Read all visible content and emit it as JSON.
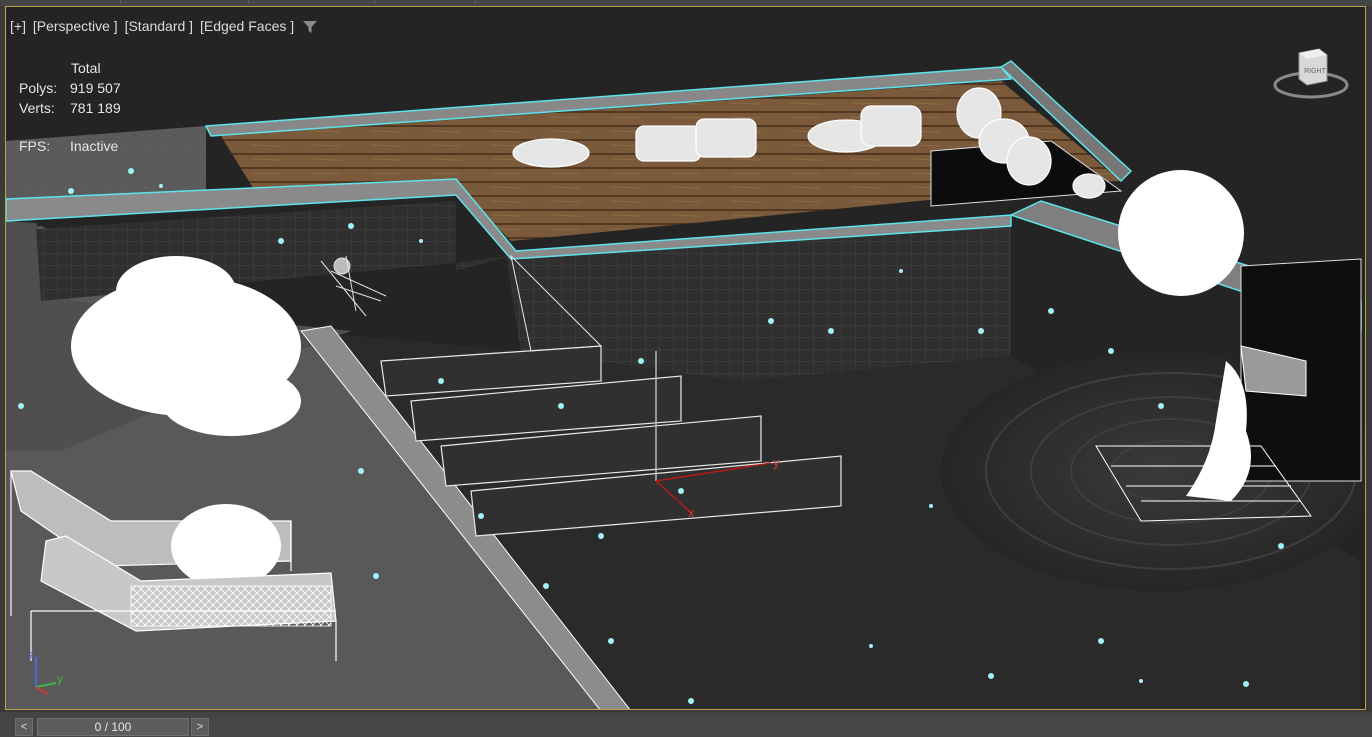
{
  "viewport": {
    "labels": [
      "[+]",
      "[Perspective ]",
      "[Standard ]",
      "[Edged Faces ]"
    ],
    "stats": {
      "header": "Total",
      "polys_label": "Polys:",
      "polys_value": "919 507",
      "verts_label": "Verts:",
      "verts_value": "781 189"
    },
    "fps": {
      "label": "FPS:",
      "value": "Inactive"
    },
    "viewcube_label": "RIGHT",
    "border_color": "#bfa248",
    "wire_color": "#5fe3ee"
  },
  "gizmo_axes": [
    "x",
    "y"
  ],
  "tripod_axes": [
    "y",
    "x",
    "z"
  ],
  "timeline": {
    "prev_label": "<",
    "frame_display": "0 / 100",
    "next_label": ">"
  },
  "icons": [
    "filter-icon",
    "viewcube-icon",
    "axis-tripod-icon"
  ]
}
